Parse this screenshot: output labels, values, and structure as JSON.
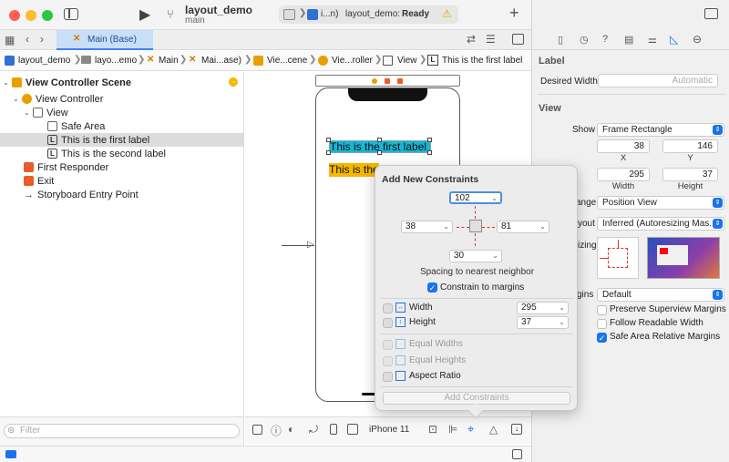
{
  "window": {
    "project_name": "layout_demo",
    "branch": "main",
    "scheme_device": "i...n)",
    "status_project": "layout_demo:",
    "status_state": "Ready",
    "tab_label": "Main (Base)"
  },
  "jumpbar": {
    "items": [
      "layout_demo",
      "layo...emo",
      "Main",
      "Mai...ase)",
      "Vie...cene",
      "Vie...roller",
      "View",
      "This is the first label"
    ]
  },
  "navigator": {
    "rows": [
      {
        "label": "View Controller Scene",
        "bold": true
      },
      {
        "label": "View Controller"
      },
      {
        "label": "View"
      },
      {
        "label": "Safe Area"
      },
      {
        "label": "This is the first label"
      },
      {
        "label": "This is the second label"
      },
      {
        "label": "First Responder"
      },
      {
        "label": "Exit"
      },
      {
        "label": "Storyboard Entry Point"
      }
    ],
    "filter_placeholder": "Filter"
  },
  "canvas": {
    "first_label": "This is the first label",
    "second_label": "This is the",
    "device": "iPhone 11"
  },
  "popover": {
    "title": "Add New Constraints",
    "top": "102",
    "left": "38",
    "right": "81",
    "bottom": "30",
    "spacing_text": "Spacing to nearest neighbor",
    "constrain_margins": "Constrain to margins",
    "width_label": "Width",
    "width_value": "295",
    "height_label": "Height",
    "height_value": "37",
    "equal_widths": "Equal Widths",
    "equal_heights": "Equal Heights",
    "aspect_ratio": "Aspect Ratio",
    "add_button": "Add Constraints"
  },
  "inspector": {
    "label_section": "Label",
    "desired_width_label": "Desired Width",
    "desired_width_value": "Automatic",
    "view_section": "View",
    "show_label": "Show",
    "show_value": "Frame Rectangle",
    "x_value": "38",
    "y_value": "146",
    "x_caption": "X",
    "y_caption": "Y",
    "width_value": "295",
    "height_value": "37",
    "width_caption": "Width",
    "height_caption": "Height",
    "arrange_label": "ange",
    "arrange_value": "Position View",
    "layout_label": "yout",
    "layout_value": "Inferred (Autoresizing Mas...",
    "autoresizing_label": "izing",
    "margins_label": "gins",
    "margins_value": "Default",
    "preserve_superview": "Preserve Superview Margins",
    "follow_readable": "Follow Readable Width",
    "safe_area_relative": "Safe Area Relative Margins"
  },
  "colors": {
    "accent": "#1a73e8",
    "label_cyan": "#1ab4d4",
    "label_yellow": "#f5b800"
  }
}
